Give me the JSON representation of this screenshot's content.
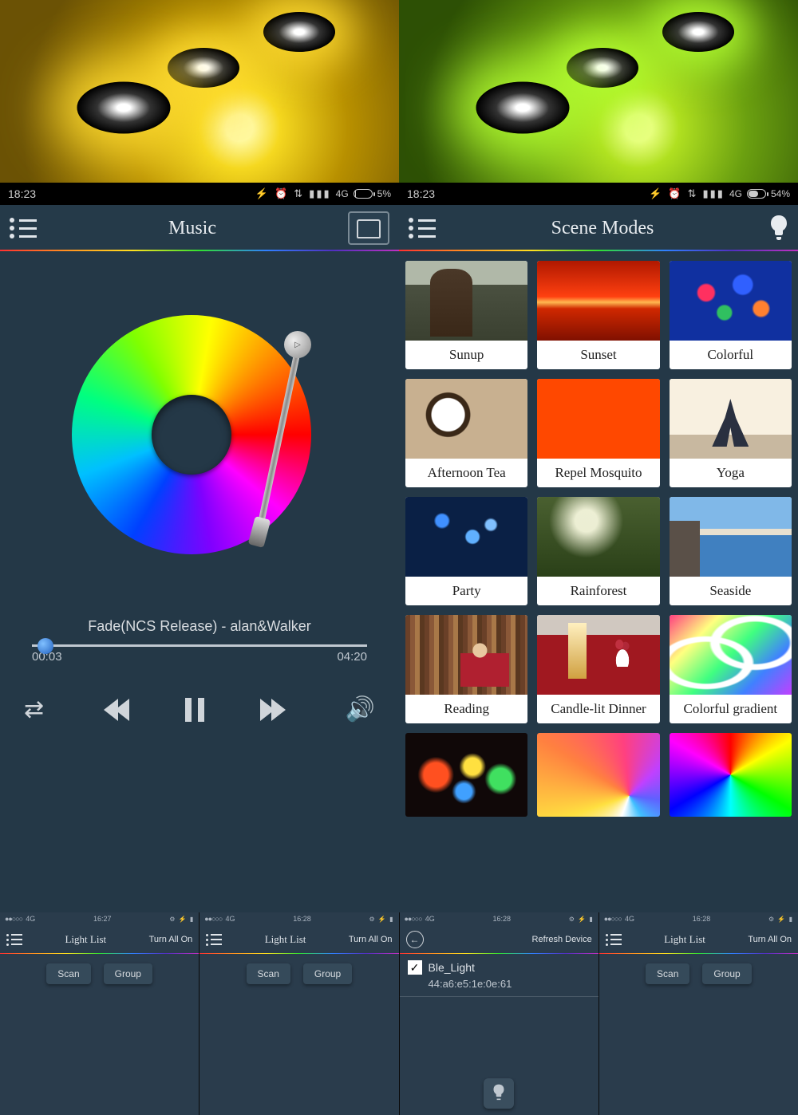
{
  "status": {
    "time": "18:23",
    "network": "4G",
    "battery_left": "5%",
    "battery_right": "54%"
  },
  "music": {
    "title": "Music",
    "track": "Fade(NCS Release) - alan&Walker",
    "elapsed": "00:03",
    "total": "04:20"
  },
  "scenes": {
    "title": "Scene Modes",
    "items": [
      {
        "label": "Sunup"
      },
      {
        "label": "Sunset"
      },
      {
        "label": "Colorful"
      },
      {
        "label": "Afternoon Tea"
      },
      {
        "label": "Repel Mosquito"
      },
      {
        "label": "Yoga"
      },
      {
        "label": "Party"
      },
      {
        "label": "Rainforest"
      },
      {
        "label": "Seaside"
      },
      {
        "label": "Reading"
      },
      {
        "label": "Candle-lit Dinner"
      },
      {
        "label": "Colorful gradient"
      }
    ]
  },
  "mini": {
    "time1": "16:27",
    "time2": "16:28",
    "network": "4G",
    "title_list": "Light List",
    "action_all_on": "Turn All On",
    "action_refresh": "Refresh Device",
    "btn_scan": "Scan",
    "btn_group": "Group",
    "device_name": "Ble_Light",
    "device_mac": "44:a6:e5:1e:0e:61"
  }
}
